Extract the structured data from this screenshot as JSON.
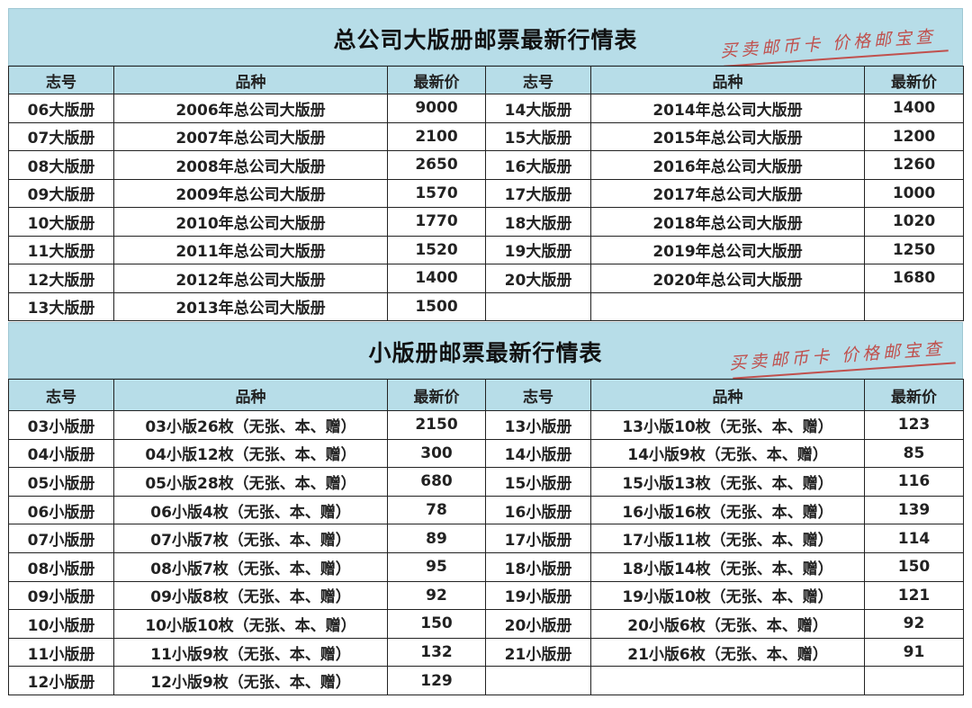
{
  "section1": {
    "title": "总公司大版册邮票最新行情表",
    "stamp": "买卖邮币卡 价格邮宝查",
    "headers": [
      "志号",
      "品种",
      "最新价",
      "志号",
      "品种",
      "最新价"
    ],
    "rows": [
      [
        "06大版册",
        "2006年总公司大版册",
        "9000",
        "14大版册",
        "2014年总公司大版册",
        "1400"
      ],
      [
        "07大版册",
        "2007年总公司大版册",
        "2100",
        "15大版册",
        "2015年总公司大版册",
        "1200"
      ],
      [
        "08大版册",
        "2008年总公司大版册",
        "2650",
        "16大版册",
        "2016年总公司大版册",
        "1260"
      ],
      [
        "09大版册",
        "2009年总公司大版册",
        "1570",
        "17大版册",
        "2017年总公司大版册",
        "1000"
      ],
      [
        "10大版册",
        "2010年总公司大版册",
        "1770",
        "18大版册",
        "2018年总公司大版册",
        "1020"
      ],
      [
        "11大版册",
        "2011年总公司大版册",
        "1520",
        "19大版册",
        "2019年总公司大版册",
        "1250"
      ],
      [
        "12大版册",
        "2012年总公司大版册",
        "1400",
        "20大版册",
        "2020年总公司大版册",
        "1680"
      ],
      [
        "13大版册",
        "2013年总公司大版册",
        "1500",
        "",
        "",
        ""
      ]
    ]
  },
  "section2": {
    "title": "小版册邮票最新行情表",
    "stamp": "买卖邮币卡 价格邮宝查",
    "headers": [
      "志号",
      "品种",
      "最新价",
      "志号",
      "品种",
      "最新价"
    ],
    "rows": [
      [
        "03小版册",
        "03小版26枚（无张、本、赠）",
        "2150",
        "13小版册",
        "13小版10枚（无张、本、赠）",
        "123"
      ],
      [
        "04小版册",
        "04小版12枚（无张、本、赠）",
        "300",
        "14小版册",
        "14小版9枚（无张、本、赠）",
        "85"
      ],
      [
        "05小版册",
        "05小版28枚（无张、本、赠）",
        "680",
        "15小版册",
        "15小版13枚（无张、本、赠）",
        "116"
      ],
      [
        "06小版册",
        "06小版4枚（无张、本、赠）",
        "78",
        "16小版册",
        "16小版16枚（无张、本、赠）",
        "139"
      ],
      [
        "07小版册",
        "07小版7枚（无张、本、赠）",
        "89",
        "17小版册",
        "17小版11枚（无张、本、赠）",
        "114"
      ],
      [
        "08小版册",
        "08小版7枚（无张、本、赠）",
        "95",
        "18小版册",
        "18小版14枚（无张、本、赠）",
        "150"
      ],
      [
        "09小版册",
        "09小版8枚（无张、本、赠）",
        "92",
        "19小版册",
        "19小版10枚（无张、本、赠）",
        "121"
      ],
      [
        "10小版册",
        "10小版10枚（无张、本、赠）",
        "150",
        "20小版册",
        "20小版6枚（无张、本、赠）",
        "92"
      ],
      [
        "11小版册",
        "11小版9枚（无张、本、赠）",
        "132",
        "21小版册",
        "21小版6枚（无张、本、赠）",
        "91"
      ],
      [
        "12小版册",
        "12小版9枚（无张、本、赠）",
        "129",
        "",
        "",
        ""
      ]
    ]
  }
}
